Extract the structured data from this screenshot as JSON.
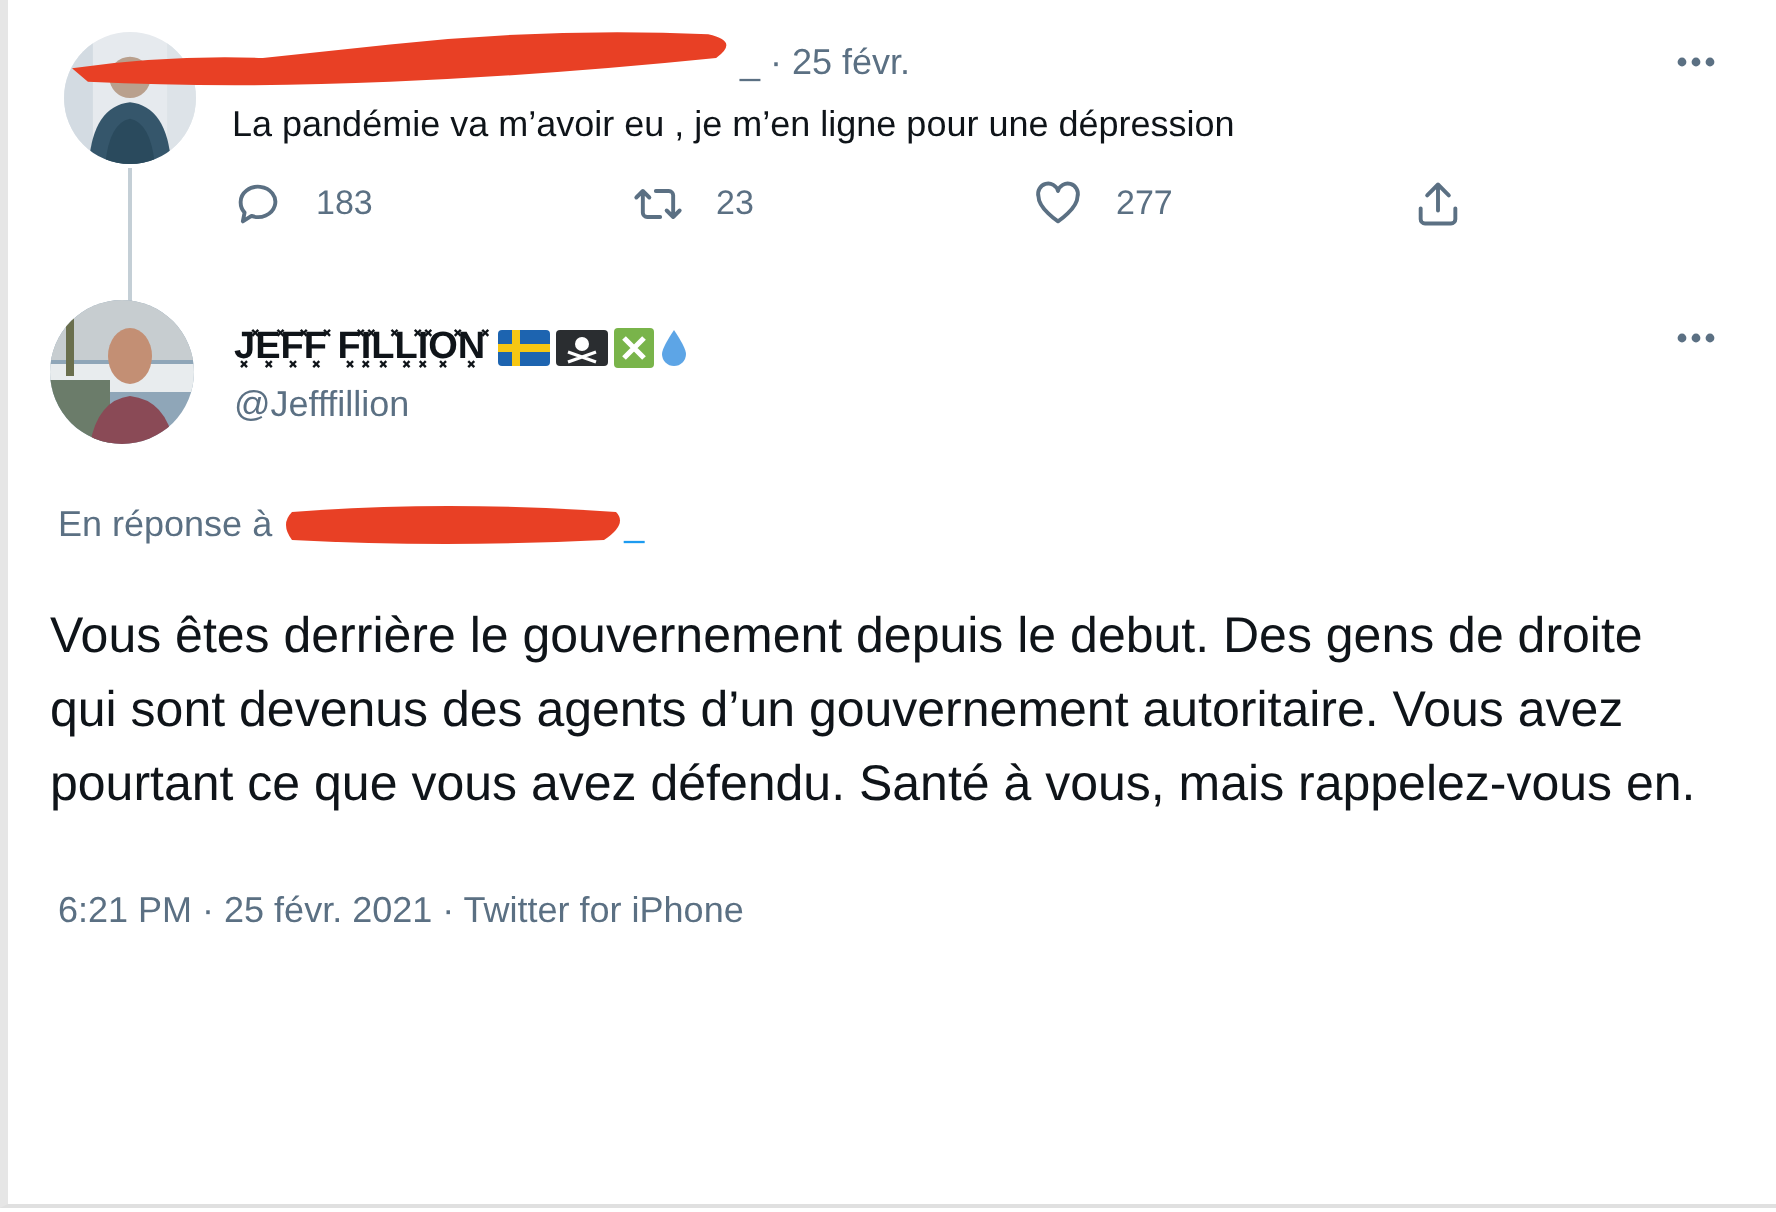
{
  "parent_tweet": {
    "meta": "_ · 25 févr.",
    "text": "La pandémie va m’avoir eu , je m’en ligne pour une dépression",
    "actions": [
      {
        "kind": "reply",
        "count": "183"
      },
      {
        "kind": "retweet",
        "count": "23"
      },
      {
        "kind": "like",
        "count": "277"
      },
      {
        "kind": "share"
      }
    ]
  },
  "tweet": {
    "display_name": "J͓̽E͓̽F͓̽F͓̽ F͓̽I͓̽L͓̽L͓̽I͓̽O͓̽N͓̽",
    "name_emojis": [
      {
        "kind": "flag-sweden"
      },
      {
        "kind": "pirate-flag"
      },
      {
        "kind": "cross-mark"
      },
      {
        "kind": "droplet"
      }
    ],
    "handle": "@Jefffillion",
    "reply_label": "En réponse à",
    "reply_to": "_",
    "text": "Vous êtes derrière le gouvernement depuis le debut. Des gens de droite qui sont devenus des agents d’un gouvernement autoritaire. Vous avez pourtant ce que vous avez défendu. Santé à vous, mais rappelez-vous en.",
    "footer": "6:21 PM · 25 févr. 2021 · Twitter for iPhone"
  }
}
